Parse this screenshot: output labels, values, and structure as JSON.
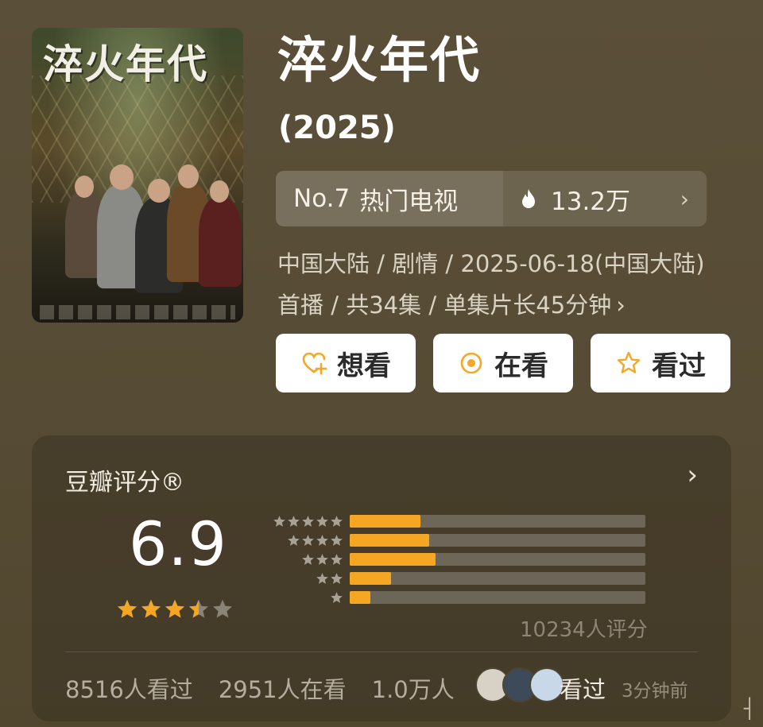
{
  "movie": {
    "title": "淬火年代",
    "year": "(2025)",
    "poster_title": "淬火年代"
  },
  "rank": {
    "position": "No.7",
    "category": "热门电视",
    "heat": "13.2万"
  },
  "meta": {
    "text": "中国大陆 / 剧情 / 2025-06-18(中国大陆)首播 / 共34集 / 单集片长45分钟"
  },
  "actions": [
    {
      "label": "想看",
      "icon": "heart-plus-icon"
    },
    {
      "label": "在看",
      "icon": "target-circle-icon"
    },
    {
      "label": "看过",
      "icon": "star-outline-icon"
    }
  ],
  "rating": {
    "title": "豆瓣评分®",
    "score": "6.9",
    "stars": 3.5,
    "distribution": [
      {
        "stars": 5,
        "fraction": 0.24
      },
      {
        "stars": 4,
        "fraction": 0.27
      },
      {
        "stars": 3,
        "fraction": 0.29
      },
      {
        "stars": 2,
        "fraction": 0.14
      },
      {
        "stars": 1,
        "fraction": 0.07
      }
    ],
    "count": "10234人评分"
  },
  "stats": {
    "watched": "8516人看过",
    "watching": "2951人在看",
    "want": "1.0万人",
    "recent_action": "看过",
    "recent_time": "3分钟前"
  },
  "corner_mark": "┤",
  "colors": {
    "accent": "#f5a623",
    "star_empty": "#8a8478",
    "background": "#574c35"
  }
}
